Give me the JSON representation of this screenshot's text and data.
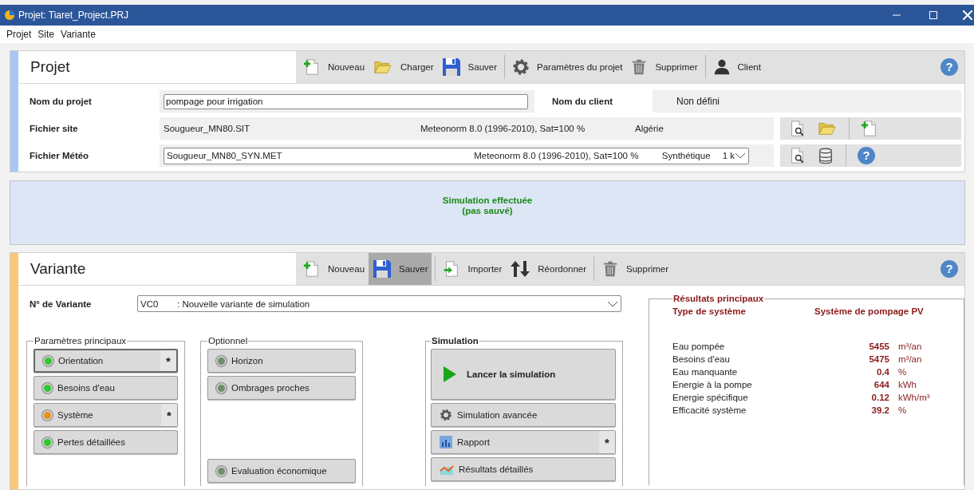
{
  "window": {
    "title": "Projet:  Tiaret_Project.PRJ"
  },
  "menu": [
    {
      "label": "Projet"
    },
    {
      "label": "Site"
    },
    {
      "label": "Variante"
    }
  ],
  "project": {
    "title": "Projet",
    "help": "?",
    "toolbar": [
      {
        "kind": "new",
        "label": "Nouveau"
      },
      {
        "kind": "open",
        "label": "Charger"
      },
      {
        "kind": "save",
        "label": "Sauver"
      },
      {
        "kind": "separator"
      },
      {
        "kind": "gear",
        "label": "Paramètres du projet"
      },
      {
        "kind": "trash",
        "label": "Supprimer"
      },
      {
        "kind": "separator"
      },
      {
        "kind": "person",
        "label": "Client"
      }
    ],
    "name_label": "Nom du projet",
    "name_value": "pompage pour irrigation",
    "client_label": "Nom du client",
    "client_value": "Non défini",
    "site_label": "Fichier site",
    "site_file": "Sougueur_MN80.SIT",
    "site_source": "Meteonorm 8.0 (1996-2010), Sat=100 %",
    "site_country": "Algérie",
    "site_tools": [
      {
        "kind": "view"
      },
      {
        "kind": "open"
      },
      {
        "kind": "separator"
      },
      {
        "kind": "new"
      }
    ],
    "meteo_label": "Fichier Météo",
    "meteo_file": "Sougueur_MN80_SYN.MET",
    "meteo_source": "Meteonorm 8.0 (1996-2010), Sat=100 %",
    "meteo_type": "Synthétique",
    "meteo_step": "1 k",
    "meteo_tools": [
      {
        "kind": "view"
      },
      {
        "kind": "database"
      },
      {
        "kind": "separator"
      },
      {
        "kind": "help",
        "label": "?"
      }
    ]
  },
  "status": {
    "lines": [
      "Simulation effectuée",
      "(pas sauvé)"
    ]
  },
  "variant": {
    "title": "Variante",
    "help": "?",
    "toolbar": [
      {
        "kind": "new",
        "label": "Nouveau",
        "selected": false
      },
      {
        "kind": "save",
        "label": "Sauver",
        "selected": true
      },
      {
        "kind": "separator"
      },
      {
        "kind": "import",
        "label": "Importer",
        "selected": false
      },
      {
        "kind": "reorder",
        "label": "Réordonner",
        "selected": false
      },
      {
        "kind": "separator"
      },
      {
        "kind": "trash",
        "label": "Supprimer",
        "selected": false
      }
    ],
    "number_label": "N° de Variante",
    "number_code": "VC0",
    "number_name": ": Nouvelle variante de simulation",
    "groups": [
      {
        "title": "Paramètres principaux",
        "bold": false,
        "buttons": [
          {
            "kind": "status",
            "label": "Orientation",
            "color": "#2ec92e",
            "mark": "*",
            "focused": true
          },
          {
            "kind": "status",
            "label": "Besoins d'eau",
            "color": "#2ec92e",
            "focused": false
          },
          {
            "kind": "status",
            "label": "Système",
            "color": "#e8901e",
            "mark": "*",
            "focused": false
          },
          {
            "kind": "status",
            "label": "Pertes détaillées",
            "color": "#2ec92e",
            "focused": false
          }
        ]
      },
      {
        "title": "Optionnel",
        "bold": false,
        "buttons": [
          {
            "kind": "status",
            "label": "Horizon",
            "color": "#6e8f6e",
            "focused": false
          },
          {
            "kind": "status",
            "label": "Ombrages proches",
            "color": "#6e8f6e",
            "focused": false
          },
          {
            "kind": "spacer"
          },
          {
            "kind": "status",
            "label": "Evaluation économique",
            "color": "#6e8f6e",
            "focused": false
          }
        ]
      },
      {
        "title": "Simulation",
        "bold": true,
        "buttons": [
          {
            "kind": "run",
            "label": "Lancer la simulation",
            "focused": false
          },
          {
            "kind": "gear",
            "label": "Simulation avancée",
            "focused": false
          },
          {
            "kind": "report",
            "label": "Rapport",
            "mark": "*",
            "focused": false
          },
          {
            "kind": "results",
            "label": "Résultats détaillés",
            "focused": false
          }
        ]
      }
    ],
    "results": {
      "title": "Résultats principaux",
      "type_label": "Type de système",
      "type_value": "Système de pompage PV",
      "rows": [
        {
          "label": "Eau pompée",
          "value": "5455",
          "unit": "m³/an"
        },
        {
          "label": "Besoins d'eau",
          "value": "5475",
          "unit": "m³/an"
        },
        {
          "label": "Eau manquante",
          "value": "0.4",
          "unit": "%"
        },
        {
          "label": "Energie à la pompe",
          "value": "644",
          "unit": "kWh"
        },
        {
          "label": "Energie spécifique",
          "value": "0.12",
          "unit": "kWh/m³"
        },
        {
          "label": "Efficacité système",
          "value": "39.2",
          "unit": "%"
        }
      ]
    }
  }
}
